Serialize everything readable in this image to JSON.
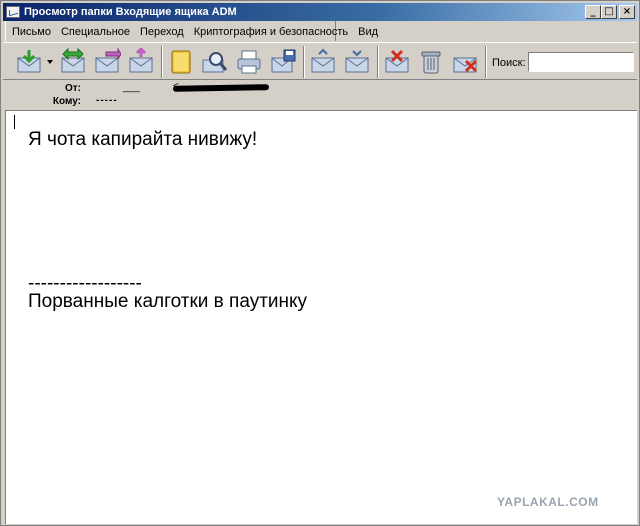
{
  "window": {
    "title": "Просмотр папки Входящие ящика ADM",
    "controls": [
      "_",
      "□",
      "×"
    ]
  },
  "menu": [
    "Письмо",
    "Специальное",
    "Переход",
    "Криптография и безопасность",
    "Вид"
  ],
  "toolbar": {
    "buttons": [
      "download-mail-icon",
      "receive-all-icon",
      "reply-icon",
      "forward-icon",
      "address-book-icon",
      "search-mail-icon",
      "print-icon",
      "save-mail-icon",
      "previous-message-icon",
      "next-message-icon",
      "spam-icon",
      "delete-icon",
      "delete-spam-icon"
    ],
    "search_label": "Поиск:",
    "search_value": ""
  },
  "header": {
    "from_label": "От:",
    "from_value": "___",
    "from_bracket": "<",
    "to_label": "Кому:",
    "to_value": "-----"
  },
  "message": {
    "line1": "Я чота капирайта нивижу!",
    "separator": "------------------",
    "line3": "Порванные калготки в паутинку"
  },
  "watermark": "YAPLAKAL.COM",
  "colors": {
    "chrome": "#d4d0c8",
    "titlebar_start": "#0a246a",
    "titlebar_end": "#a6caf0"
  }
}
